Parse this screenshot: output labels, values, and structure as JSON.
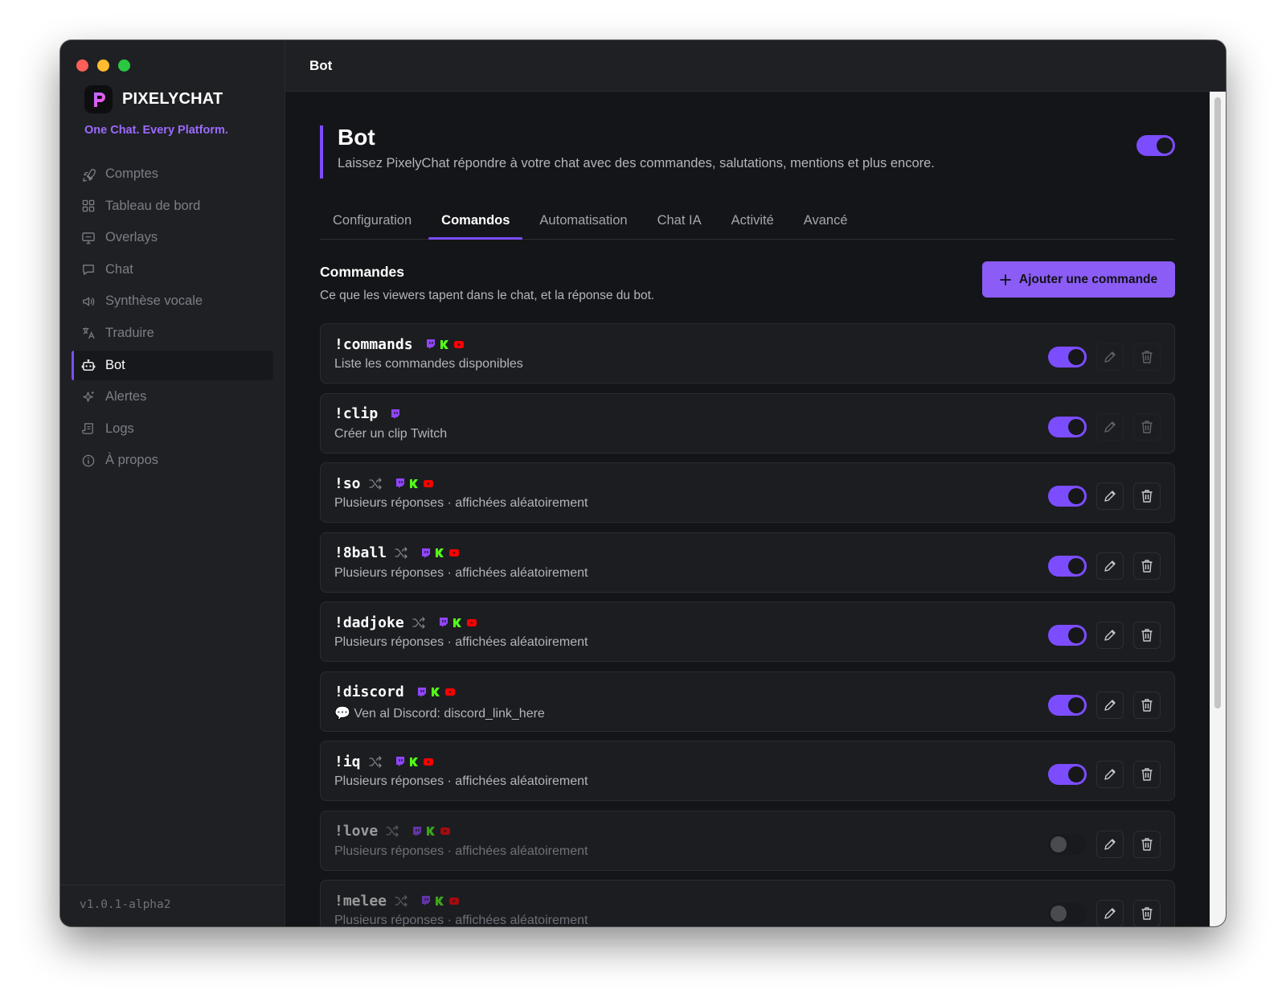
{
  "app": {
    "name": "PIXELYCHAT",
    "tagline": "One Chat. Every Platform.",
    "version": "v1.0.1-alpha2"
  },
  "sidebar": {
    "items": [
      {
        "label": "Comptes",
        "icon": "rocket-icon"
      },
      {
        "label": "Tableau de bord",
        "icon": "dashboard-icon"
      },
      {
        "label": "Overlays",
        "icon": "monitor-icon"
      },
      {
        "label": "Chat",
        "icon": "chat-bubble-icon"
      },
      {
        "label": "Synthèse vocale",
        "icon": "speaker-icon"
      },
      {
        "label": "Traduire",
        "icon": "translate-icon"
      },
      {
        "label": "Bot",
        "icon": "bot-icon",
        "active": true
      },
      {
        "label": "Alertes",
        "icon": "sparkle-icon"
      },
      {
        "label": "Logs",
        "icon": "scroll-icon"
      },
      {
        "label": "À propos",
        "icon": "info-icon"
      }
    ]
  },
  "topbar": {
    "title": "Bot"
  },
  "header": {
    "title": "Bot",
    "subtitle": "Laissez PixelyChat répondre à votre chat avec des commandes, salutations, mentions et plus encore.",
    "enabled": true
  },
  "tabs": [
    {
      "label": "Configuration"
    },
    {
      "label": "Comandos",
      "active": true
    },
    {
      "label": "Automatisation"
    },
    {
      "label": "Chat IA"
    },
    {
      "label": "Activité"
    },
    {
      "label": "Avancé"
    }
  ],
  "commands_section": {
    "title": "Commandes",
    "subtitle": "Ce que les viewers tapent dans le chat, et la réponse du bot.",
    "add_button": "Ajouter une commande"
  },
  "commands": [
    {
      "name": "!commands",
      "desc": "Liste les commandes disponibles",
      "random": false,
      "platforms": [
        "twitch",
        "kick",
        "youtube"
      ],
      "enabled": true,
      "editable": false
    },
    {
      "name": "!clip",
      "desc": "Créer un clip Twitch",
      "random": false,
      "platforms": [
        "twitch"
      ],
      "enabled": true,
      "editable": false
    },
    {
      "name": "!so",
      "desc": "Plusieurs réponses · affichées aléatoirement",
      "random": true,
      "platforms": [
        "twitch",
        "kick",
        "youtube"
      ],
      "enabled": true,
      "editable": true
    },
    {
      "name": "!8ball",
      "desc": "Plusieurs réponses · affichées aléatoirement",
      "random": true,
      "platforms": [
        "twitch",
        "kick",
        "youtube"
      ],
      "enabled": true,
      "editable": true
    },
    {
      "name": "!dadjoke",
      "desc": "Plusieurs réponses · affichées aléatoirement",
      "random": true,
      "platforms": [
        "twitch",
        "kick",
        "youtube"
      ],
      "enabled": true,
      "editable": true
    },
    {
      "name": "!discord",
      "desc": "💬 Ven al Discord: discord_link_here",
      "random": false,
      "platforms": [
        "twitch",
        "kick",
        "youtube"
      ],
      "enabled": true,
      "editable": true
    },
    {
      "name": "!iq",
      "desc": "Plusieurs réponses · affichées aléatoirement",
      "random": true,
      "platforms": [
        "twitch",
        "kick",
        "youtube"
      ],
      "enabled": true,
      "editable": true
    },
    {
      "name": "!love",
      "desc": "Plusieurs réponses · affichées aléatoirement",
      "random": true,
      "platforms": [
        "twitch",
        "kick",
        "youtube"
      ],
      "enabled": false,
      "editable": true
    },
    {
      "name": "!melee",
      "desc": "Plusieurs réponses · affichées aléatoirement",
      "random": true,
      "platforms": [
        "twitch",
        "kick",
        "youtube"
      ],
      "enabled": false,
      "editable": true
    }
  ],
  "colors": {
    "accent": "#7c4dff",
    "twitch": "#9146ff",
    "kick": "#53fc18",
    "youtube": "#ff0000"
  }
}
